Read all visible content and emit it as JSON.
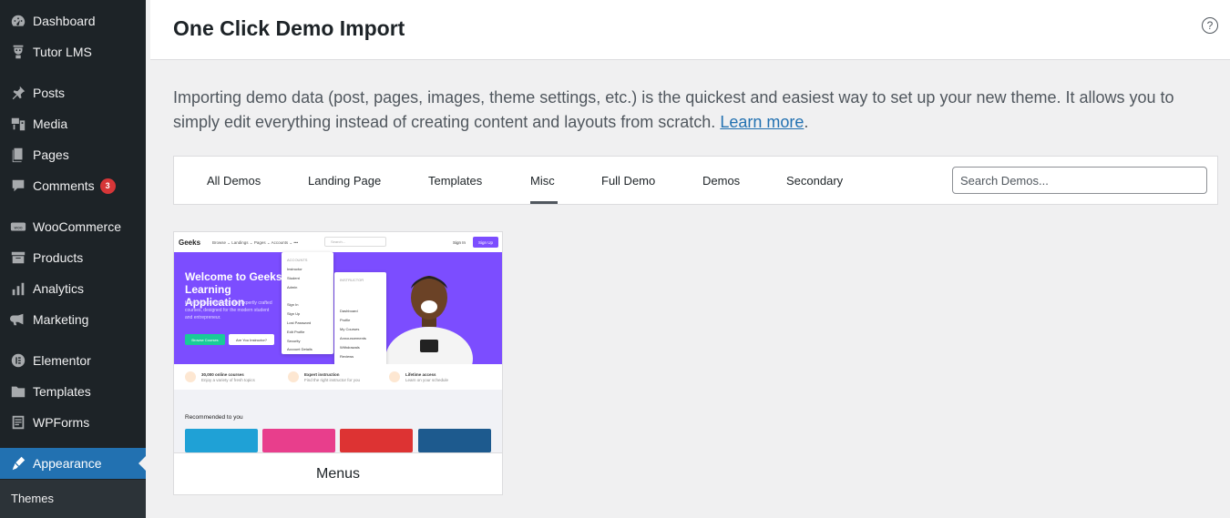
{
  "sidebar": {
    "items": [
      {
        "label": "Dashboard",
        "icon": "dashboard-icon"
      },
      {
        "label": "Tutor LMS",
        "icon": "tutor-icon"
      },
      {
        "label": "Posts",
        "icon": "pin-icon"
      },
      {
        "label": "Media",
        "icon": "media-icon"
      },
      {
        "label": "Pages",
        "icon": "pages-icon"
      },
      {
        "label": "Comments",
        "icon": "comment-icon",
        "badge": "3"
      },
      {
        "label": "WooCommerce",
        "icon": "woo-icon"
      },
      {
        "label": "Products",
        "icon": "archive-icon"
      },
      {
        "label": "Analytics",
        "icon": "chart-icon"
      },
      {
        "label": "Marketing",
        "icon": "megaphone-icon"
      },
      {
        "label": "Elementor",
        "icon": "elementor-icon"
      },
      {
        "label": "Templates",
        "icon": "folder-icon"
      },
      {
        "label": "WPForms",
        "icon": "forms-icon"
      },
      {
        "label": "Appearance",
        "icon": "brush-icon",
        "active": true
      }
    ],
    "submenu": {
      "label": "Themes"
    }
  },
  "header": {
    "title": "One Click Demo Import",
    "help_icon": "?"
  },
  "intro": {
    "text": "Importing demo data (post, pages, images, theme settings, etc.) is the quickest and easiest way to set up your new theme. It allows you to simply edit everything instead of creating content and layouts from scratch. ",
    "link": "Learn more",
    "after": "."
  },
  "tabs": {
    "items": [
      "All Demos",
      "Landing Page",
      "Templates",
      "Misc",
      "Full Demo",
      "Demos",
      "Secondary"
    ],
    "active": "Misc",
    "search_placeholder": "Search Demos..."
  },
  "demo": {
    "name": "Menus",
    "preview": {
      "logo": "Geeks",
      "nav": "Browse ⌄   Landings ⌄   Pages ⌄   Accounts ⌄   •••",
      "search": "Search...",
      "signin": "Sign In",
      "signup": "Sign Up",
      "heading": "Welcome to Geeks Learning Application",
      "subtext": "Hand-picked Instructor and expertly crafted courses, designed for the modern student and entrepreneur.",
      "btn_primary": "Browse Courses",
      "btn_secondary": "Are You Instructor?",
      "menu1": [
        "ACCOUNTS",
        "Instructor",
        "Student",
        "Admin",
        "Sign In",
        "Sign Up",
        "Lost Password",
        "Edit Profile",
        "Security",
        "Account Details"
      ],
      "menu2": [
        "INSTRUCTOR",
        "Dashboard",
        "Profile",
        "My Courses",
        "Announcements",
        "Withdrawals",
        "Reviews"
      ],
      "features": [
        {
          "title": "30,000 online courses",
          "sub": "Enjoy a variety of fresh topics"
        },
        {
          "title": "Expert instruction",
          "sub": "Find the right instructor for you"
        },
        {
          "title": "Lifetime access",
          "sub": "Learn on your schedule"
        }
      ],
      "recommended": "Recommended to you",
      "tile_colors": [
        "#1fa1d6",
        "#e83e8c",
        "#dd3333",
        "#1d5a8e"
      ]
    }
  }
}
